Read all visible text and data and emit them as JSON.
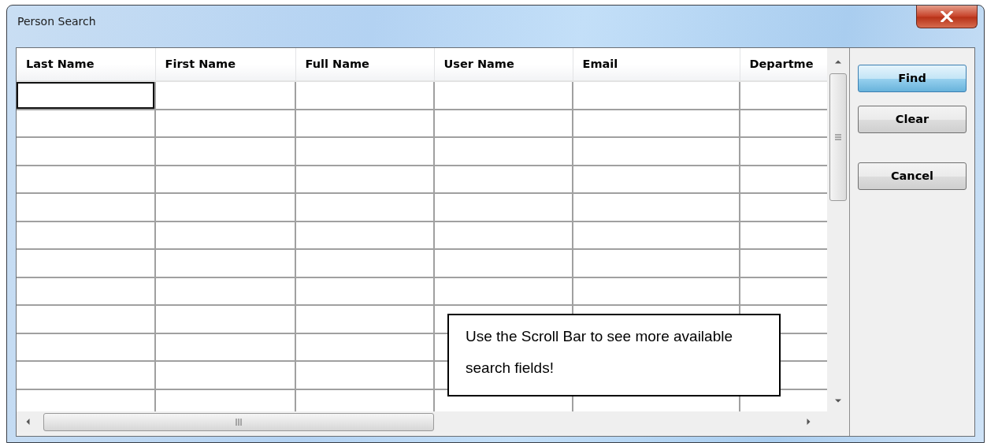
{
  "window": {
    "title": "Person Search"
  },
  "table": {
    "columns": [
      "Last Name",
      "First Name",
      "Full Name",
      "User Name",
      "Email",
      "Departme"
    ],
    "rows": [
      {
        "focused": true
      },
      {
        "focused": false
      },
      {
        "focused": false
      },
      {
        "focused": false
      },
      {
        "focused": false
      },
      {
        "focused": false
      },
      {
        "focused": false
      },
      {
        "focused": false
      },
      {
        "focused": false
      },
      {
        "focused": false
      },
      {
        "focused": false
      },
      {
        "focused": false
      }
    ]
  },
  "buttons": [
    {
      "label": "Find",
      "default": true
    },
    {
      "label": "Clear",
      "default": false
    },
    {
      "label": "Cancel",
      "default": false
    }
  ],
  "callout": {
    "text": "Use the Scroll Bar to see more available search fields!"
  }
}
